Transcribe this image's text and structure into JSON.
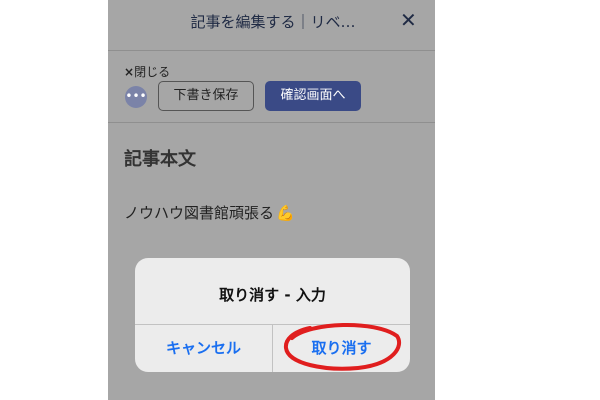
{
  "header": {
    "title": "記事を編集する｜リベ…",
    "close_icon": "✕"
  },
  "toolbar": {
    "close_label": "閉じる",
    "close_icon": "×",
    "more_icon": "•••",
    "draft_label": "下書き保存",
    "confirm_label": "確認画面へ"
  },
  "content": {
    "section_title": "記事本文",
    "body_text": "ノウハウ図書館頑張る",
    "emoji": "💪"
  },
  "alert": {
    "title": "取り消す - 入力",
    "cancel_label": "キャンセル",
    "undo_label": "取り消す"
  },
  "colors": {
    "overlay_bg": "#a6a6a6",
    "primary_button": "#3a4a86",
    "alert_button_text": "#1a6ff0",
    "annotation": "#e01e1e"
  }
}
